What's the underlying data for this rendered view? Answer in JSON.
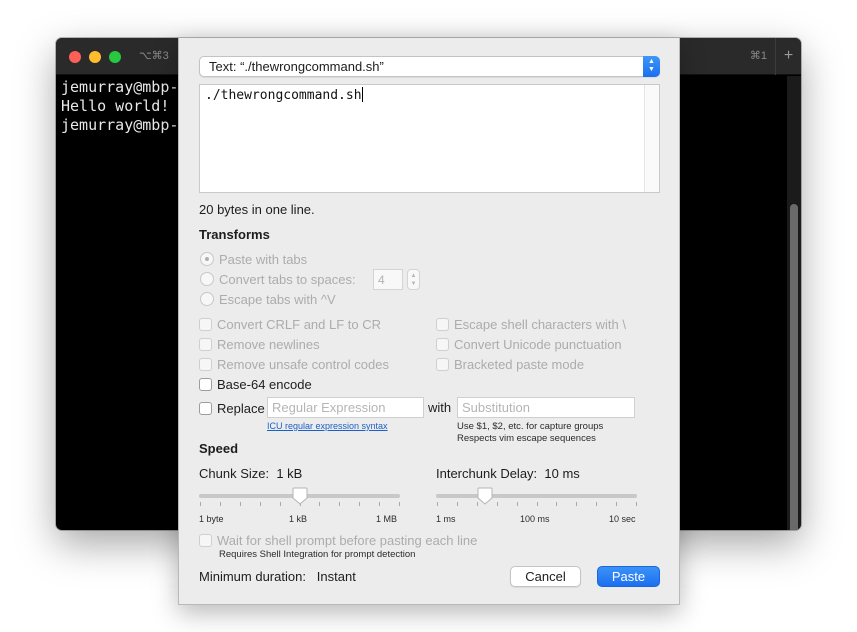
{
  "terminal": {
    "tab_shortcut_left": "⌥⌘3",
    "tab_shortcut_right": "⌘1",
    "new_tab_label": "+",
    "lines": [
      "jemurray@mbp-",
      "Hello world!",
      "jemurray@mbp-"
    ]
  },
  "dialog": {
    "source_popup": "Text: “./thewrongcommand.sh”",
    "editor_text": "./thewrongcommand.sh",
    "info": "20 bytes in one line.",
    "transforms": {
      "title": "Transforms",
      "paste_with_tabs": "Paste with tabs",
      "convert_tabs": "Convert tabs to spaces:",
      "tab_spaces_value": "4",
      "escape_tabs": "Escape tabs with ^V",
      "convert_crlf": "Convert CRLF and LF to CR",
      "remove_newlines": "Remove newlines",
      "remove_unsafe": "Remove unsafe control codes",
      "escape_shell": "Escape shell characters with \\",
      "convert_unicode": "Convert Unicode punctuation",
      "bracketed_paste": "Bracketed paste mode",
      "base64": "Base-64 encode",
      "replace_label": "Replace",
      "regex_placeholder": "Regular Expression",
      "with_label": "with",
      "substitution_placeholder": "Substitution",
      "icu_link": "ICU regular expression syntax",
      "hint_line1": "Use $1, $2, etc. for capture groups",
      "hint_line2": "Respects vim escape sequences"
    },
    "speed": {
      "title": "Speed",
      "chunk_size_label": "Chunk Size:",
      "chunk_size_value": "1 kB",
      "chunk_ticks": [
        "1 byte",
        "1 kB",
        "1 MB"
      ],
      "chunk_position": 0.5,
      "delay_label": "Interchunk Delay:",
      "delay_value": "10 ms",
      "delay_ticks": [
        "1 ms",
        "100 ms",
        "10 sec"
      ],
      "delay_position": 0.22
    },
    "wait_prompt": "Wait for shell prompt before pasting each line",
    "wait_hint": "Requires Shell Integration for prompt detection",
    "min_duration_label": "Minimum duration:",
    "min_duration_value": "Instant",
    "cancel": "Cancel",
    "paste": "Paste",
    "colors": {
      "accent": "#1c6ff0",
      "link": "#1b60c9"
    }
  }
}
